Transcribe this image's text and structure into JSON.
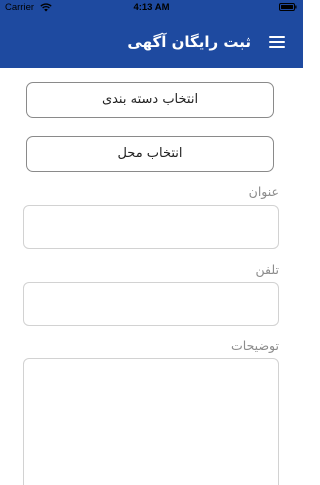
{
  "status_bar": {
    "carrier": "Carrier",
    "time": "4:13 AM"
  },
  "header": {
    "title": "ثبت رایگان آگهی",
    "menu_icon": "hamburger-menu-icon",
    "background_color": "#1e4aa0"
  },
  "form": {
    "category_button": "انتخاب دسته بندی",
    "location_button": "انتخاب محل",
    "title_label": "عنوان",
    "title_value": "",
    "phone_label": "تلفن",
    "phone_value": "",
    "description_label": "توضیحات",
    "description_value": ""
  }
}
